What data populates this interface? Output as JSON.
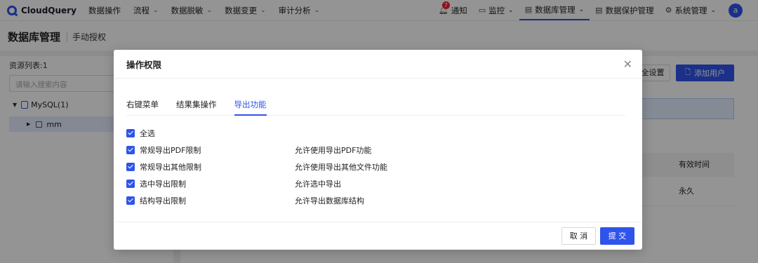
{
  "topnav": {
    "brand": "CloudQuery",
    "items": [
      {
        "label": "数据操作",
        "chevron": false
      },
      {
        "label": "流程",
        "chevron": true
      },
      {
        "label": "数据脱敏",
        "chevron": true
      },
      {
        "label": "数据变更",
        "chevron": true
      },
      {
        "label": "审计分析",
        "chevron": true
      }
    ],
    "right": {
      "notify_label": "通知",
      "notify_count": "7",
      "monitor_label": "监控",
      "dbmgmt_label": "数据库管理",
      "protect_label": "数据保护管理",
      "sysmgmt_label": "系统管理",
      "avatar_letter": "a"
    }
  },
  "page": {
    "title": "数据库管理",
    "subtitle": "手动授权",
    "resource_list_label": "资源列表:1",
    "search_placeholder": "请输入搜索内容",
    "tree_root": "MySQL(1)",
    "tree_child": "mm",
    "btn_setall": "全设置",
    "btn_add_user": "添加用户",
    "col_valid_time": "有效时间",
    "cell_valid_time": "永久"
  },
  "modal": {
    "title": "操作权限",
    "tabs": [
      {
        "label": "右键菜单",
        "active": false
      },
      {
        "label": "结果集操作",
        "active": false
      },
      {
        "label": "导出功能",
        "active": true
      }
    ],
    "select_all": "全选",
    "permissions": [
      {
        "label": "常规导出PDF限制",
        "desc": "允许使用导出PDF功能",
        "checked": true
      },
      {
        "label": "常规导出其他限制",
        "desc": "允许使用导出其他文件功能",
        "checked": true
      },
      {
        "label": "选中导出限制",
        "desc": "允许选中导出",
        "checked": true
      },
      {
        "label": "结构导出限制",
        "desc": "允许导出数据库结构",
        "checked": true
      }
    ],
    "cancel_label": "取 消",
    "submit_label": "提 交"
  },
  "colors": {
    "accent": "#2f54eb",
    "badge": "#f5222d"
  }
}
